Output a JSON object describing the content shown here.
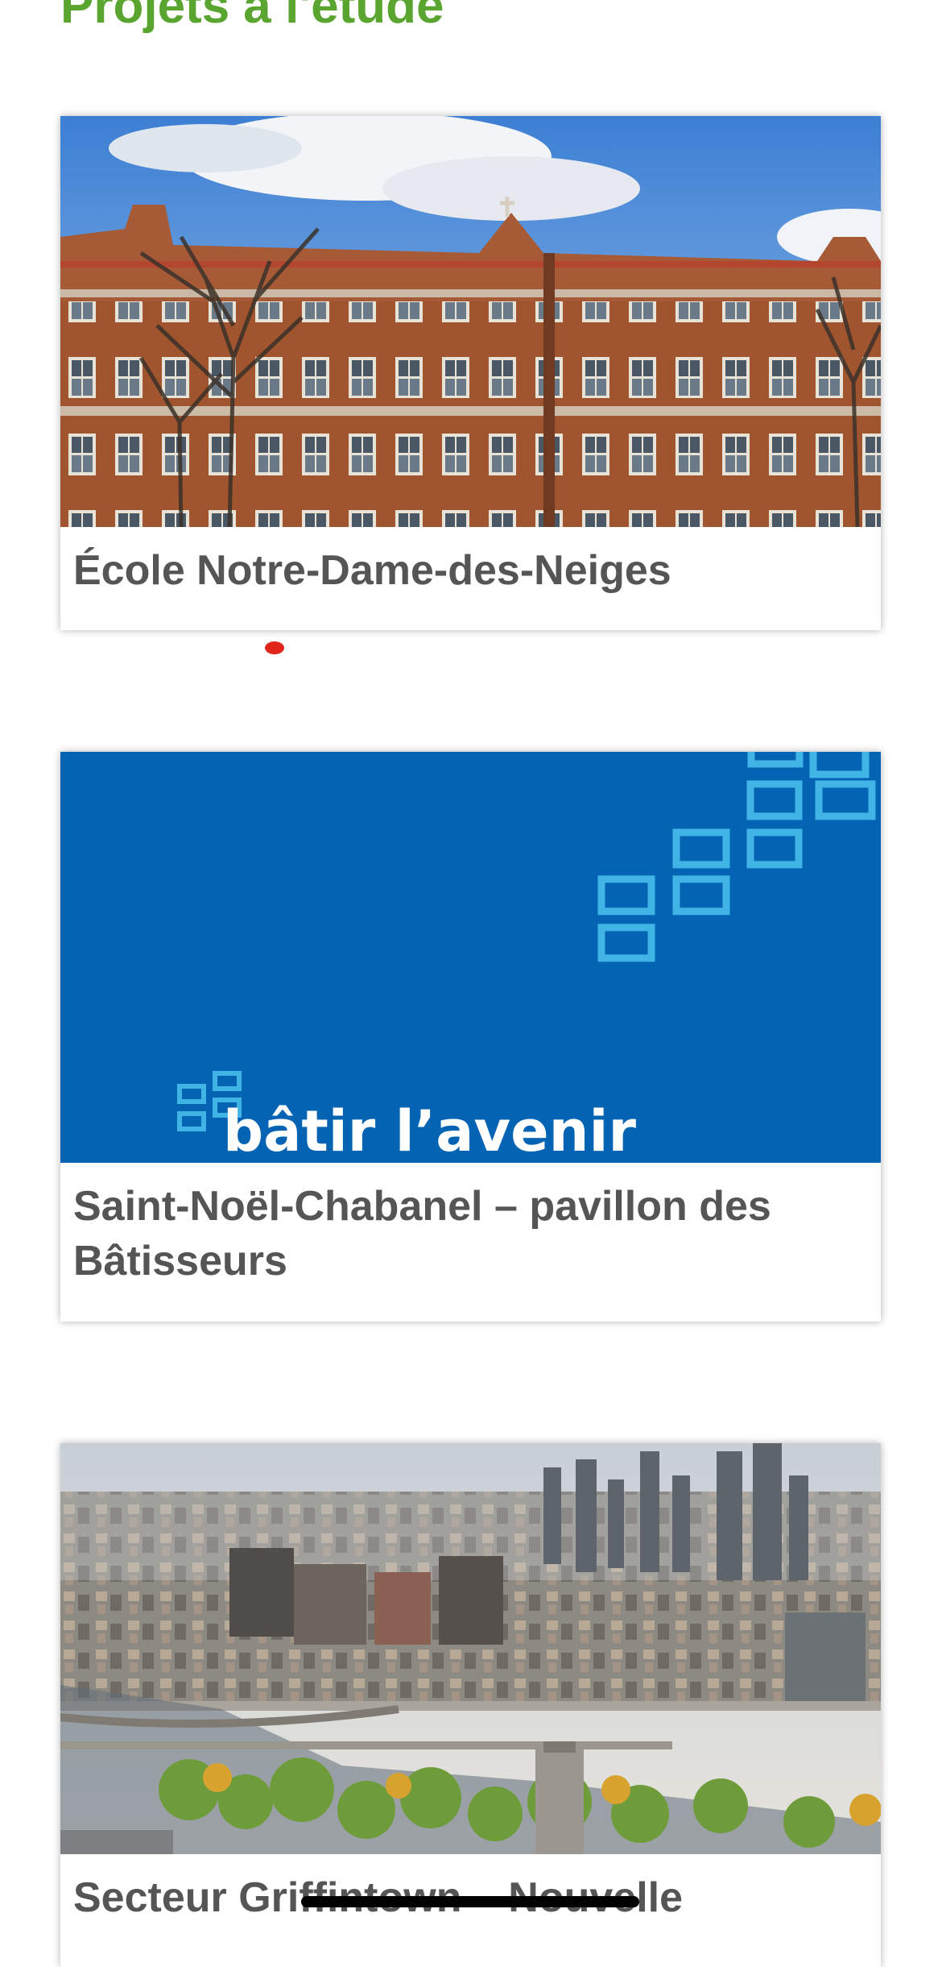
{
  "section": {
    "heading": "Projets à l'étude"
  },
  "projects": [
    {
      "title": "École Notre-Dame-des-Neiges",
      "image_icon": "school-building-photo-icon"
    },
    {
      "title": "Saint-Noël-Chabanel – pavillon des Bâtisseurs",
      "image_icon": "batir-lavenir-banner-icon",
      "banner_text": "bâtir l’avenir",
      "banner_color": "#0563b3",
      "banner_accent_color": "#40b4e5"
    },
    {
      "title": "Secteur Griffintown – Nouvelle",
      "image_icon": "city-skyline-photo-icon"
    }
  ],
  "colors": {
    "heading": "#5aa52f",
    "title_text": "#555555",
    "indicator_dot": "#e0251b"
  }
}
